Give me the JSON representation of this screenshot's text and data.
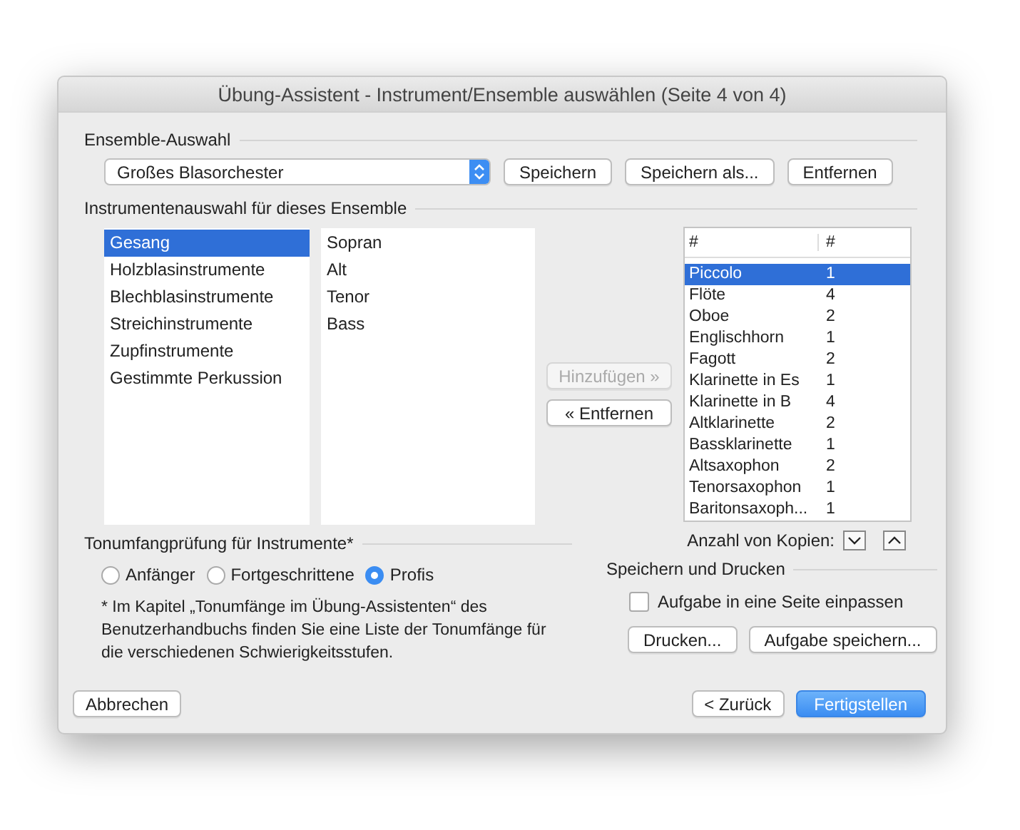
{
  "window": {
    "title": "Übung-Assistent - Instrument/Ensemble auswählen (Seite 4 von 4)"
  },
  "ensemble_section": {
    "heading": "Ensemble-Auswahl",
    "dropdown": {
      "value": "Großes Blasorchester"
    },
    "buttons": [
      "Speichern",
      "Speichern als...",
      "Entfernen"
    ]
  },
  "instrument_section": {
    "heading": "Instrumentenauswahl für dieses Ensemble",
    "families": [
      {
        "label": "Gesang",
        "selected": true
      },
      {
        "label": "Holzblasinstrumente",
        "selected": false
      },
      {
        "label": "Blechblasinstrumente",
        "selected": false
      },
      {
        "label": "Streichinstrumente",
        "selected": false
      },
      {
        "label": "Zupfinstrumente",
        "selected": false
      },
      {
        "label": "Gestimmte Perkussion",
        "selected": false
      }
    ],
    "instruments": [
      "Sopran",
      "Alt",
      "Tenor",
      "Bass"
    ],
    "transfer_buttons": [
      {
        "label": "Hinzufügen »",
        "disabled": true
      },
      {
        "label": "« Entfernen",
        "disabled": false
      }
    ],
    "ensemble_table": {
      "columns": [
        "#",
        "#"
      ],
      "rows": [
        {
          "name": "Piccolo",
          "count": "1",
          "selected": true
        },
        {
          "name": "Flöte",
          "count": "4",
          "selected": false
        },
        {
          "name": "Oboe",
          "count": "2",
          "selected": false
        },
        {
          "name": "Englischhorn",
          "count": "1",
          "selected": false
        },
        {
          "name": "Fagott",
          "count": "2",
          "selected": false
        },
        {
          "name": "Klarinette in Es",
          "count": "1",
          "selected": false
        },
        {
          "name": "Klarinette in B",
          "count": "4",
          "selected": false
        },
        {
          "name": "Altklarinette",
          "count": "2",
          "selected": false
        },
        {
          "name": "Bassklarinette",
          "count": "1",
          "selected": false
        },
        {
          "name": "Altsaxophon",
          "count": "2",
          "selected": false
        },
        {
          "name": "Tenorsaxophon",
          "count": "1",
          "selected": false
        },
        {
          "name": "Baritonsaxoph...",
          "count": "1",
          "selected": false
        }
      ]
    },
    "copies_label": "Anzahl von Kopien:"
  },
  "range_check": {
    "heading": "Tonumfangprüfung für Instrumente*",
    "options": [
      {
        "label": "Anfänger",
        "selected": false
      },
      {
        "label": "Fortgeschrittene",
        "selected": false
      },
      {
        "label": "Profis",
        "selected": true
      }
    ],
    "note": "* Im Kapitel „Tonumfänge im Übung-Assistenten“ des Benutzerhandbuchs finden Sie eine Liste der Tonumfänge für die verschiedenen Schwierigkeitsstufen."
  },
  "save_print": {
    "heading": "Speichern und Drucken",
    "checkbox": {
      "label": "Aufgabe in eine Seite einpassen",
      "checked": false
    },
    "buttons": [
      "Drucken...",
      "Aufgabe speichern..."
    ]
  },
  "footer": {
    "buttons": [
      {
        "label": "Abbrechen",
        "kind": "normal"
      },
      {
        "label": "< Zurück",
        "kind": "normal"
      },
      {
        "label": "Fertigstellen",
        "kind": "default"
      }
    ]
  }
}
